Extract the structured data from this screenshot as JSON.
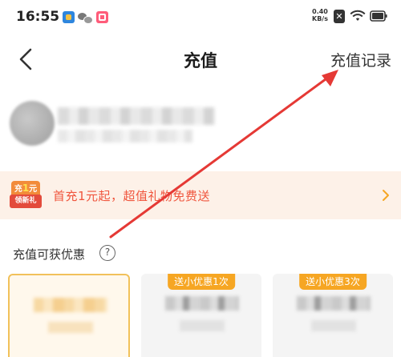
{
  "status_bar": {
    "time": "16:55",
    "net_speed_value": "0.40",
    "net_speed_unit": "KB/s",
    "icons": [
      "app-notification-icon",
      "wechat-icon",
      "app-notification-icon",
      "no-sim-icon",
      "wifi-icon",
      "battery-icon"
    ]
  },
  "nav": {
    "title": "充值",
    "records_link": "充值记录",
    "back_icon": "chevron-left-icon"
  },
  "user": {
    "avatar": "avatar",
    "name": "",
    "subtitle": ""
  },
  "promo": {
    "badge_top_prefix": "充",
    "badge_top_emphasis": "1",
    "badge_top_suffix": "元",
    "badge_bottom": "领新礼",
    "text": "首充1元起，超值礼物免费送",
    "chevron_icon": "chevron-right-icon"
  },
  "section": {
    "title": "充值可获优惠",
    "help_label": "?"
  },
  "options": [
    {
      "tag": "",
      "selected": true
    },
    {
      "tag": "送小优惠1次",
      "selected": false
    },
    {
      "tag": "送小优惠3次",
      "selected": false
    }
  ],
  "colors": {
    "accent_orange": "#f6a623",
    "promo_text": "#f0553d",
    "promo_bg": "#fdf1e8",
    "selected_border": "#f1c15a",
    "annotation_red": "#e53935"
  }
}
